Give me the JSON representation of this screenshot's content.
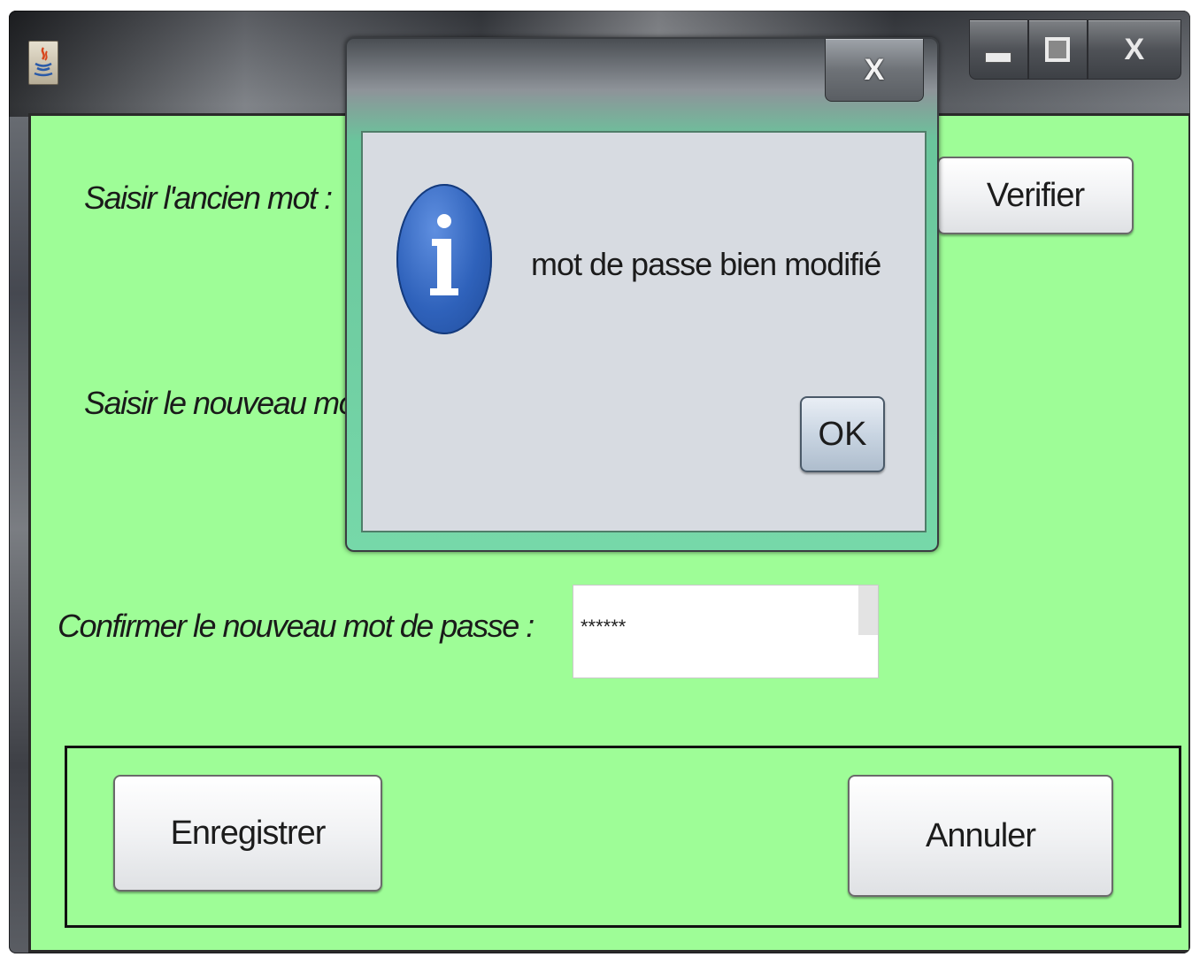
{
  "window": {
    "close_glyph": "X"
  },
  "form": {
    "old_password_label": "Saisir l'ancien mot  :",
    "new_password_label": "Saisir le nouveau mot d",
    "confirm_password_label": "Confirmer le nouveau mot de passe :",
    "confirm_password_value": "******",
    "verify_button": "Verifier",
    "save_button": "Enregistrer",
    "cancel_button": "Annuler"
  },
  "dialog": {
    "close_glyph": "X",
    "message": "mot de passe bien modifié",
    "ok_button": "OK",
    "icon": "info-icon"
  },
  "colors": {
    "panel_background": "#9efd97",
    "dialog_background": "#d7dbe1",
    "info_icon_blue": "#2f62bb"
  }
}
